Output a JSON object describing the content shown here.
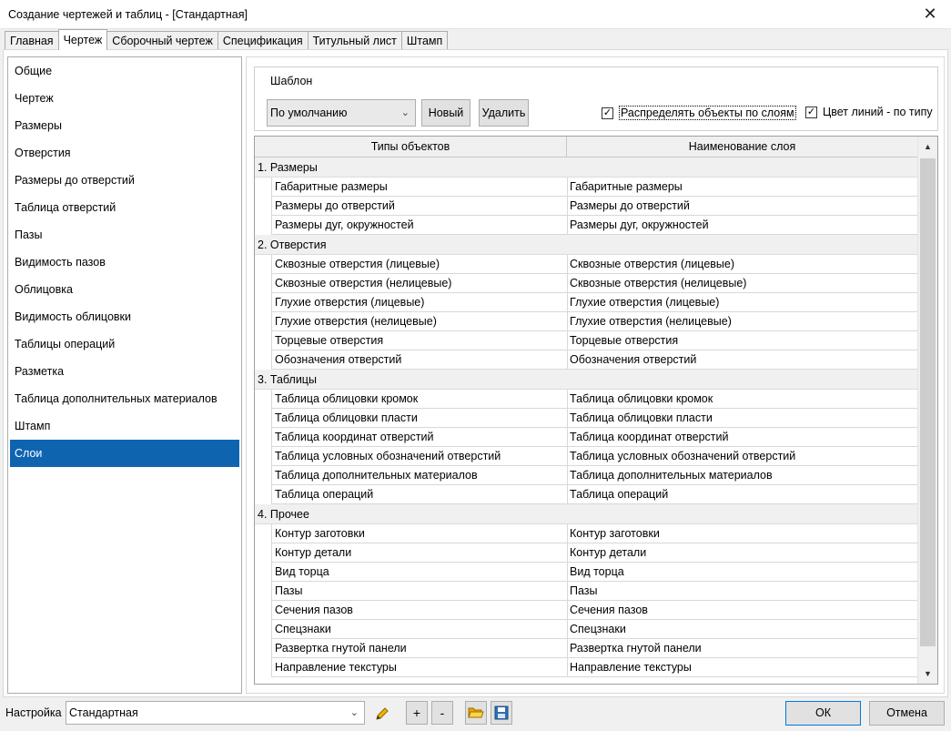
{
  "window": {
    "title": "Создание чертежей и таблиц - [Стандартная]"
  },
  "tabs": [
    "Главная",
    "Чертеж",
    "Сборочный чертеж",
    "Спецификация",
    "Титульный лист",
    "Штамп"
  ],
  "sidebar": {
    "items": [
      "Общие",
      "Чертеж",
      "Размеры",
      "Отверстия",
      "Размеры до отверстий",
      "Таблица отверстий",
      "Пазы",
      "Видимость пазов",
      "Облицовка",
      "Видимость облицовки",
      "Таблицы операций",
      "Разметка",
      "Таблица дополнительных материалов",
      "Штамп",
      "Слои"
    ],
    "selected": "Слои"
  },
  "template": {
    "legend": "Шаблон",
    "selected": "По умолчанию",
    "new_label": "Новый",
    "delete_label": "Удалить",
    "distribute_label": "Распределять объекты по слоям",
    "distribute_checked": true,
    "linecolor_label": "Цвет линий - по типу",
    "linecolor_checked": true
  },
  "grid": {
    "col1": "Типы объектов",
    "col2": "Наименование слоя",
    "groups": [
      {
        "name": "1. Размеры",
        "rows": [
          [
            "Габаритные размеры",
            "Габаритные размеры"
          ],
          [
            "Размеры до отверстий",
            "Размеры до отверстий"
          ],
          [
            "Размеры дуг, окружностей",
            "Размеры дуг, окружностей"
          ]
        ]
      },
      {
        "name": "2. Отверстия",
        "rows": [
          [
            "Сквозные отверстия (лицевые)",
            "Сквозные отверстия (лицевые)"
          ],
          [
            "Сквозные отверстия (нелицевые)",
            "Сквозные отверстия (нелицевые)"
          ],
          [
            "Глухие отверстия (лицевые)",
            "Глухие отверстия (лицевые)"
          ],
          [
            "Глухие отверстия (нелицевые)",
            "Глухие отверстия (нелицевые)"
          ],
          [
            "Торцевые отверстия",
            "Торцевые отверстия"
          ],
          [
            "Обозначения отверстий",
            "Обозначения отверстий"
          ]
        ]
      },
      {
        "name": "3. Таблицы",
        "rows": [
          [
            "Таблица облицовки кромок",
            "Таблица облицовки кромок"
          ],
          [
            "Таблица облицовки пласти",
            "Таблица облицовки пласти"
          ],
          [
            "Таблица координат отверстий",
            "Таблица координат отверстий"
          ],
          [
            "Таблица условных обозначений отверстий",
            "Таблица условных обозначений отверстий"
          ],
          [
            "Таблица дополнительных материалов",
            "Таблица дополнительных материалов"
          ],
          [
            "Таблица операций",
            "Таблица операций"
          ]
        ]
      },
      {
        "name": "4. Прочее",
        "rows": [
          [
            "Контур заготовки",
            "Контур заготовки"
          ],
          [
            "Контур детали",
            "Контур детали"
          ],
          [
            "Вид торца",
            "Вид торца"
          ],
          [
            "Пазы",
            "Пазы"
          ],
          [
            "Сечения пазов",
            "Сечения пазов"
          ],
          [
            "Спецзнаки",
            "Спецзнаки"
          ],
          [
            "Развертка гнутой панели",
            "Развертка гнутой панели"
          ],
          [
            "Направление текстуры",
            "Направление текстуры"
          ]
        ]
      }
    ]
  },
  "footer": {
    "label": "Настройка",
    "preset": "Стандартная",
    "plus": "+",
    "minus": "-",
    "ok": "ОК",
    "cancel": "Отмена"
  },
  "icons": {
    "close": "close-icon",
    "pencil": "pencil-icon",
    "folder": "folder-open-icon",
    "save": "save-icon"
  },
  "colors": {
    "selection": "#0f64b0",
    "ok_border": "#0078d7"
  }
}
